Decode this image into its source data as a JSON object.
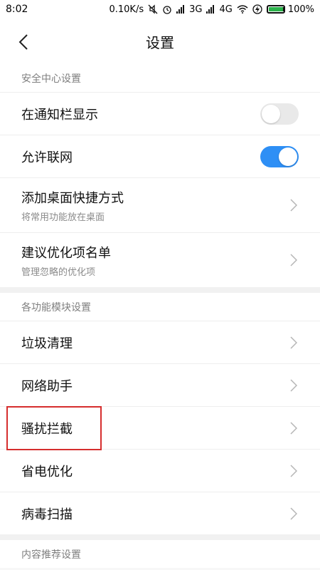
{
  "status_bar": {
    "time": "8:02",
    "net_speed": "0.10K/s",
    "network_3g": "3G",
    "network_4g": "4G",
    "battery_percent": "100%",
    "icons": [
      "mute-icon",
      "alarm-icon",
      "signal-icon",
      "wifi-icon",
      "charging-icon",
      "battery-icon"
    ]
  },
  "nav": {
    "title": "设置"
  },
  "sections": {
    "security": {
      "header": "安全中心设置",
      "notify_bar": {
        "title": "在通知栏显示",
        "enabled": false
      },
      "allow_network": {
        "title": "允许联网",
        "enabled": true
      },
      "shortcut": {
        "title": "添加桌面快捷方式",
        "subtitle": "将常用功能放在桌面"
      },
      "optimize_list": {
        "title": "建议优化项名单",
        "subtitle": "管理忽略的优化项"
      }
    },
    "modules": {
      "header": "各功能模块设置",
      "items": [
        {
          "title": "垃圾清理"
        },
        {
          "title": "网络助手"
        },
        {
          "title": "骚扰拦截"
        },
        {
          "title": "省电优化"
        },
        {
          "title": "病毒扫描"
        }
      ]
    },
    "content": {
      "header": "内容推荐设置"
    }
  },
  "colors": {
    "accent": "#2e8ff5",
    "highlight": "#d62e2e"
  }
}
